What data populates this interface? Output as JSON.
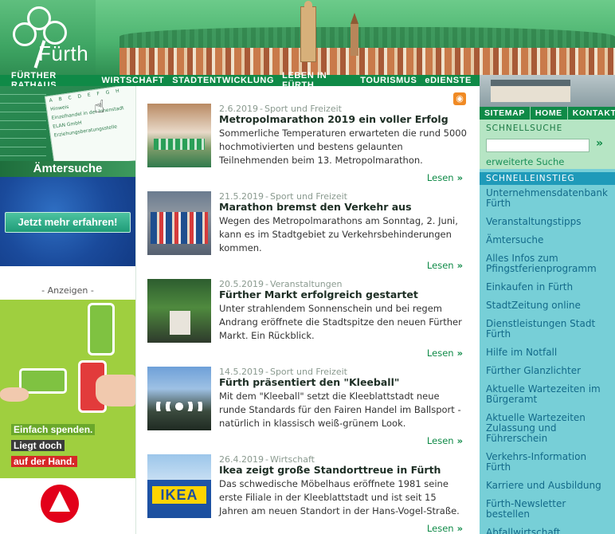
{
  "header": {
    "logo_text": "Fürth"
  },
  "main_nav": [
    {
      "label": "FÜRTHER RATHAUS"
    },
    {
      "label": "WIRTSCHAFT"
    },
    {
      "label": "STADTENTWICKLUNG"
    },
    {
      "label": "LEBEN IN FÜRTH"
    },
    {
      "label": "TOURISMUS"
    },
    {
      "label": "eDIENSTE"
    }
  ],
  "util_nav": [
    {
      "label": "SITEMAP"
    },
    {
      "label": "HOME"
    },
    {
      "label": "KONTAKT"
    }
  ],
  "left": {
    "amt_title": "Ämtersuche",
    "amt_page_alphabet": "A B C D E F G H",
    "amt_page_lines": [
      "Hinweis",
      "Einzelhandel in der Innenstadt",
      "ELAN GmbH",
      "Erziehungsberatungsstelle"
    ],
    "promo_button": "Jetzt mehr erfahren!",
    "ads_label": "- Anzeigen -",
    "ad_lines": [
      "Einfach spenden.",
      "Liegt doch",
      "auf der Hand."
    ]
  },
  "news": [
    {
      "date": "2.6.2019",
      "category": "Sport und Freizeit",
      "title": "Metropolmarathon 2019 ein voller Erfolg",
      "text": "Sommerliche Temperaturen erwarteten die rund 5000 hochmotivierten und bestens gelaunten Teilnehmenden beim 13. Metropolmarathon.",
      "more": "Lesen"
    },
    {
      "date": "21.5.2019",
      "category": "Sport und Freizeit",
      "title": "Marathon bremst den Verkehr aus",
      "text": "Wegen des Metropolmarathons am Sonntag, 2. Juni, kann es im Stadtgebiet zu Verkehrsbehinderungen kommen.",
      "more": "Lesen"
    },
    {
      "date": "20.5.2019",
      "category": "Veranstaltungen",
      "title": "Fürther Markt erfolgreich gestartet",
      "text": "Unter strahlendem Sonnenschein und bei regem Andrang eröffnete die Stadtspitze den neuen Fürther Markt. Ein Rückblick.",
      "more": "Lesen"
    },
    {
      "date": "14.5.2019",
      "category": "Sport und Freizeit",
      "title": "Fürth präsentiert den \"Kleeball\"",
      "text": "Mit dem \"Kleeball\" setzt die Kleeblattstadt neue runde Standards für den Fairen Handel im Ballsport - natürlich in klassisch weiß-grünem Look.",
      "more": "Lesen"
    },
    {
      "date": "26.4.2019",
      "category": "Wirtschaft",
      "title": "Ikea zeigt große Standorttreue in Fürth",
      "text": "Das schwedische Möbelhaus eröffnete 1981 seine erste Filiale in der Kleeblattstadt und ist seit 15 Jahren am neuen Standort in der Hans-Vogel-Straße.",
      "more": "Lesen",
      "thumb_text": "IKEA"
    }
  ],
  "right": {
    "search_title": "SCHNELLSUCHE",
    "search_value": "",
    "search_advanced": "erweiterte Suche",
    "quick_title": "SCHNELLEINSTIEG",
    "quick_links": [
      "Unternehmensdatenbank Fürth",
      "Veranstaltungstipps",
      "Ämtersuche",
      "Alles Infos zum Pfingstferienprogramm",
      "Einkaufen in Fürth",
      "StadtZeitung online",
      "Dienstleistungen Stadt Fürth",
      "Hilfe im Notfall",
      "Fürther Glanzlichter",
      "Aktuelle Wartezeiten im Bürgeramt",
      "Aktuelle Wartezeiten Zulassung und Führerschein",
      "Verkehrs-Information Fürth",
      "Karriere und Ausbildung",
      "Fürth-Newsletter bestellen",
      "Abfallwirtschaft"
    ]
  },
  "colors": {
    "brand_green": "#0f8a47",
    "link_teal": "#136a8a",
    "sidebar_teal": "#77cfd7",
    "search_bg": "#b6e5c4"
  },
  "icons": {
    "rss": "rss-icon",
    "arrow": "double-chevron-right-icon"
  }
}
